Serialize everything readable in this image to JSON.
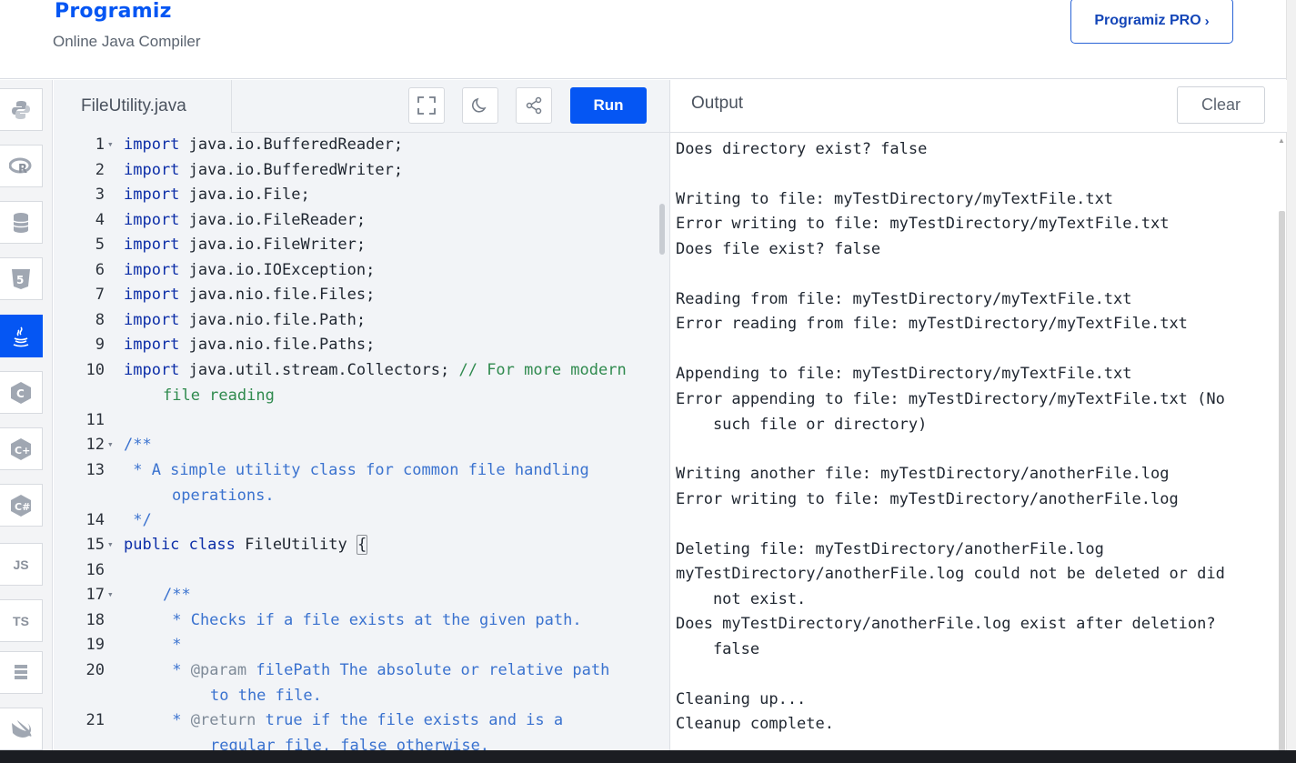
{
  "header": {
    "logo": "Programiz",
    "subtitle": "Online Java Compiler",
    "pro_button": "Programiz PRO"
  },
  "sidebar": {
    "items": [
      {
        "icon": "python-icon"
      },
      {
        "icon": "r-icon"
      },
      {
        "icon": "database-icon"
      },
      {
        "icon": "html5-icon"
      },
      {
        "icon": "java-icon",
        "active": true
      },
      {
        "icon": "c-icon"
      },
      {
        "icon": "cpp-icon"
      },
      {
        "icon": "csharp-icon"
      },
      {
        "icon": "js-icon",
        "label": "JS"
      },
      {
        "icon": "ts-icon",
        "label": "TS"
      },
      {
        "icon": "go-icon"
      },
      {
        "icon": "swift-icon"
      }
    ]
  },
  "editor": {
    "file_name": "FileUtility.java",
    "run_label": "Run",
    "lines": [
      {
        "n": "1",
        "fold": true
      },
      {
        "n": "2"
      },
      {
        "n": "3"
      },
      {
        "n": "4"
      },
      {
        "n": "5"
      },
      {
        "n": "6"
      },
      {
        "n": "7"
      },
      {
        "n": "8"
      },
      {
        "n": "9"
      },
      {
        "n": "10"
      },
      {
        "n": "11"
      },
      {
        "n": "12",
        "fold": true
      },
      {
        "n": "13"
      },
      {
        "n": "14"
      },
      {
        "n": "15",
        "fold": true
      },
      {
        "n": "16"
      },
      {
        "n": "17",
        "fold": true
      },
      {
        "n": "18"
      },
      {
        "n": "19"
      },
      {
        "n": "20"
      },
      {
        "n": "21"
      }
    ],
    "code": {
      "l1": "java.io.BufferedReader;",
      "l2": "java.io.BufferedWriter;",
      "l3": "java.io.File;",
      "l4": "java.io.FileReader;",
      "l5": "java.io.FileWriter;",
      "l6": "java.io.IOException;",
      "l7": "java.nio.file.Files;",
      "l8": "java.nio.file.Path;",
      "l9": "java.nio.file.Paths;",
      "l10": "java.util.stream.Collectors; ",
      "l10_comment": "// For more modern",
      "l10_comment_cont": "file reading",
      "l12": "/**",
      "l13": " * A simple utility class for common file handling",
      "l13_cont": "operations.",
      "l14": " */",
      "l15_kw1": "public",
      "l15_kw2": "class",
      "l15_name": "FileUtility",
      "l15_brace": "{",
      "l17": "/**",
      "l18": " * Checks if a file exists at the given path.",
      "l19": " *",
      "l20_star": " * ",
      "l20_tag": "@param",
      "l20_rest": " filePath The absolute or relative path",
      "l20_cont": "to the file.",
      "l21_star": " * ",
      "l21_tag": "@return",
      "l21_rest": " true if the file exists and is a",
      "l21_cont": "regular file, false otherwise.",
      "import_kw": "import"
    }
  },
  "output": {
    "title": "Output",
    "clear_label": "Clear",
    "lines": [
      "Does directory exist? false",
      "",
      "Writing to file: myTestDirectory/myTextFile.txt",
      "Error writing to file: myTestDirectory/myTextFile.txt",
      "Does file exist? false",
      "",
      "Reading from file: myTestDirectory/myTextFile.txt",
      "Error reading from file: myTestDirectory/myTextFile.txt",
      "",
      "Appending to file: myTestDirectory/myTextFile.txt",
      "Error appending to file: myTestDirectory/myTextFile.txt (No",
      "    such file or directory)",
      "",
      "Writing another file: myTestDirectory/anotherFile.log",
      "Error writing to file: myTestDirectory/anotherFile.log",
      "",
      "Deleting file: myTestDirectory/anotherFile.log",
      "myTestDirectory/anotherFile.log could not be deleted or did",
      "    not exist.",
      "Does myTestDirectory/anotherFile.log exist after deletion?",
      "    false",
      "",
      "Cleaning up...",
      "Cleanup complete."
    ]
  }
}
